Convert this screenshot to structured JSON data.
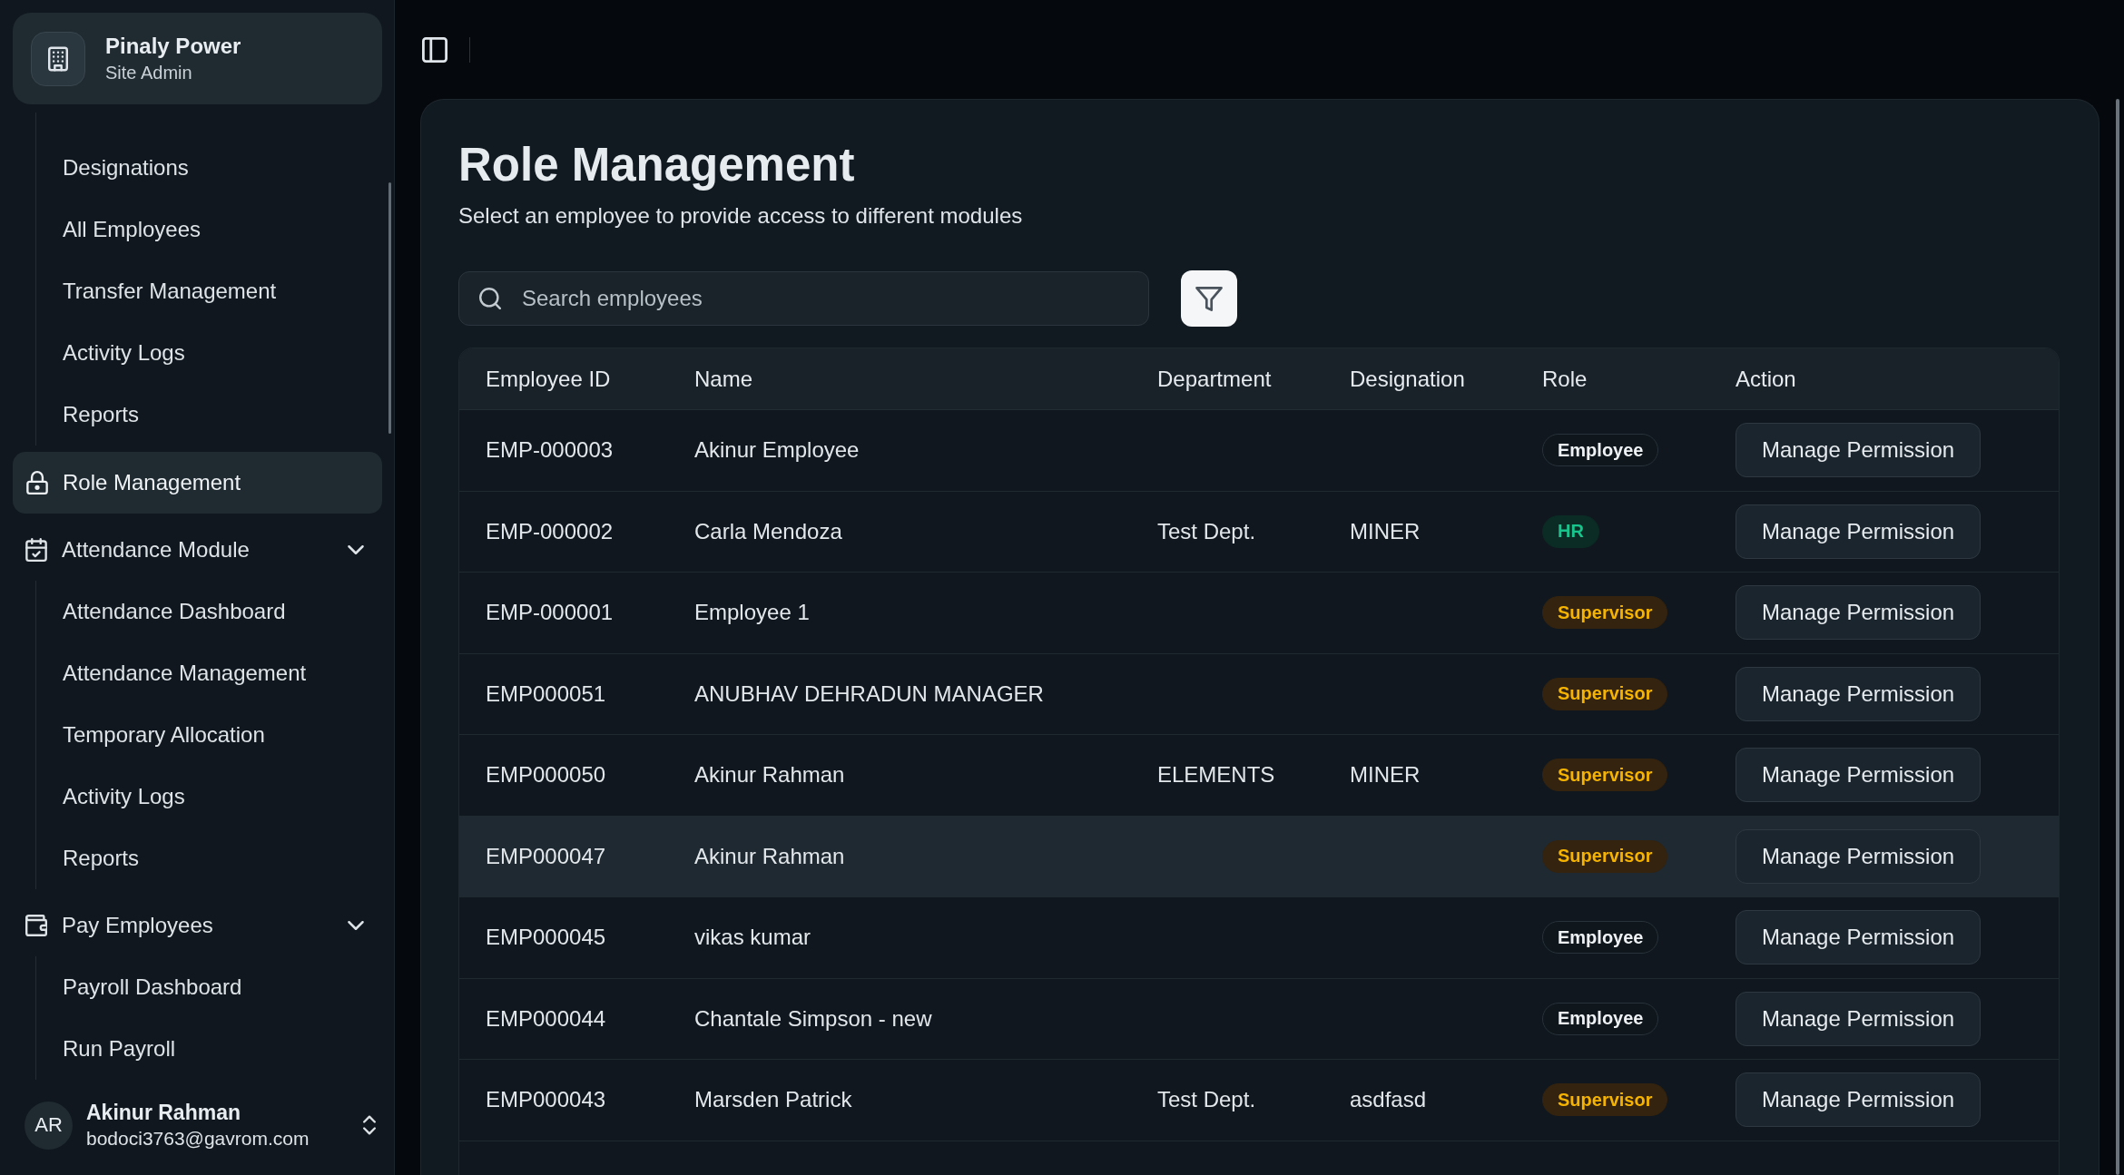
{
  "sidebar": {
    "org": {
      "name": "Pinaly Power",
      "role": "Site Admin"
    },
    "nav": [
      {
        "kind": "sublist",
        "children": [
          {
            "label": "Designations",
            "selected": false
          },
          {
            "label": "All Employees",
            "selected": false
          },
          {
            "label": "Transfer Management",
            "selected": false
          },
          {
            "label": "Activity Logs",
            "selected": false
          },
          {
            "label": "Reports",
            "selected": false
          }
        ]
      },
      {
        "kind": "link",
        "label": "Role Management",
        "selected": true
      },
      {
        "kind": "group",
        "label": "Attendance Module",
        "expanded": true,
        "children": [
          {
            "label": "Attendance Dashboard",
            "selected": false
          },
          {
            "label": "Attendance Management",
            "selected": false
          },
          {
            "label": "Temporary Allocation",
            "selected": false
          },
          {
            "label": "Activity Logs",
            "selected": false
          },
          {
            "label": "Reports",
            "selected": false
          }
        ]
      },
      {
        "kind": "group",
        "label": "Pay Employees",
        "expanded": true,
        "children": [
          {
            "label": "Payroll Dashboard",
            "selected": false
          },
          {
            "label": "Run Payroll",
            "selected": false
          }
        ]
      }
    ],
    "user": {
      "initials": "AR",
      "name": "Akinur Rahman",
      "email": "bodoci3763@gavrom.com"
    }
  },
  "page": {
    "title": "Role Management",
    "subtitle": "Select an employee to provide access to different modules"
  },
  "search": {
    "placeholder": "Search employees"
  },
  "table": {
    "columns": [
      "Employee ID",
      "Name",
      "Department",
      "Designation",
      "Role",
      "Action"
    ],
    "rows": [
      {
        "employee_id": "EMP-000003",
        "name": "Akinur Employee",
        "role": {
          "label": "Employee",
          "kind": "neutral"
        },
        "action": "Manage Permission",
        "hovered": false
      },
      {
        "employee_id": "EMP-000002",
        "name": "Carla Mendoza",
        "department": "Test Dept.",
        "designation": "MINER",
        "role": {
          "label": "HR",
          "kind": "success"
        },
        "action": "Manage Permission",
        "hovered": false
      },
      {
        "employee_id": "EMP-000001",
        "name": "Employee 1",
        "role": {
          "label": "Supervisor",
          "kind": "warning"
        },
        "action": "Manage Permission",
        "hovered": false
      },
      {
        "employee_id": "EMP000051",
        "name": "ANUBHAV DEHRADUN MANAGER",
        "role": {
          "label": "Supervisor",
          "kind": "warning"
        },
        "action": "Manage Permission",
        "hovered": false
      },
      {
        "employee_id": "EMP000050",
        "name": "Akinur Rahman",
        "department": "ELEMENTS",
        "designation": "MINER",
        "role": {
          "label": "Supervisor",
          "kind": "warning"
        },
        "action": "Manage Permission",
        "hovered": false
      },
      {
        "employee_id": "EMP000047",
        "name": "Akinur Rahman",
        "role": {
          "label": "Supervisor",
          "kind": "warning"
        },
        "action": "Manage Permission",
        "hovered": true
      },
      {
        "employee_id": "EMP000045",
        "name": "vikas kumar",
        "role": {
          "label": "Employee",
          "kind": "neutral"
        },
        "action": "Manage Permission",
        "hovered": false
      },
      {
        "employee_id": "EMP000044",
        "name": "Chantale Simpson - new",
        "role": {
          "label": "Employee",
          "kind": "neutral"
        },
        "action": "Manage Permission",
        "hovered": false
      },
      {
        "employee_id": "EMP000043",
        "name": "Marsden Patrick",
        "department": "Test Dept.",
        "designation": "asdfasd",
        "role": {
          "label": "Supervisor",
          "kind": "warning"
        },
        "action": "Manage Permission",
        "hovered": false
      }
    ]
  }
}
